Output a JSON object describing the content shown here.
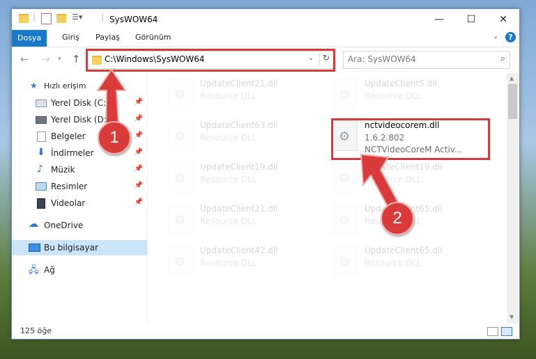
{
  "window": {
    "title": "SysWOW64"
  },
  "ribbon": {
    "tabs": [
      "Dosya",
      "Giriş",
      "Paylaş",
      "Görünüm"
    ]
  },
  "address": {
    "path": "C:\\Windows\\SysWOW64",
    "search_placeholder": "Ara: SysWOW64"
  },
  "sidebar": {
    "items": [
      {
        "label": "Hızlı erişim",
        "icon": "star-icon"
      },
      {
        "label": "Yerel Disk (C:)",
        "icon": "drive-icon"
      },
      {
        "label": "Yerel Disk (D:)",
        "icon": "drive-icon"
      },
      {
        "label": "Belgeler",
        "icon": "documents-icon"
      },
      {
        "label": "İndirmeler",
        "icon": "download-icon"
      },
      {
        "label": "Müzik",
        "icon": "music-icon"
      },
      {
        "label": "Resimler",
        "icon": "pictures-icon"
      },
      {
        "label": "Videolar",
        "icon": "videos-icon"
      },
      {
        "label": "OneDrive",
        "icon": "cloud-icon"
      },
      {
        "label": "Bu bilgisayar",
        "icon": "computer-icon"
      },
      {
        "label": "Ağ",
        "icon": "network-icon"
      }
    ]
  },
  "files": [
    {
      "name": "UpdateClient21.dll",
      "type": "Resource DLL"
    },
    {
      "name": "UpdateClient5.dll",
      "type": "Resource DLL"
    },
    {
      "name": "UpdateClient63.dll",
      "type": "Resource DLL"
    },
    {
      "name": "nctvideocorem.dll",
      "version": "1.6.2.802",
      "description": "NCTVideoCoreM Activ..."
    },
    {
      "name": "UpdateClient19.dll",
      "type": "Resource DLL"
    },
    {
      "name": "UpdateClient19.dll",
      "type": "Resource DLL"
    },
    {
      "name": "UpdateClient21.dll",
      "type": "Resource DLL"
    },
    {
      "name": "UpdateClient65.dll",
      "type": "Resource DLL"
    },
    {
      "name": "UpdateClient42.dll",
      "type": "Resource DLL"
    },
    {
      "name": "UpdateClient65.dll",
      "type": "Resource DLL"
    }
  ],
  "status": {
    "item_count": "125 öğe"
  },
  "callouts": [
    "1",
    "2"
  ],
  "colors": {
    "accent": "#1979ca",
    "highlight": "#d43a3a"
  }
}
